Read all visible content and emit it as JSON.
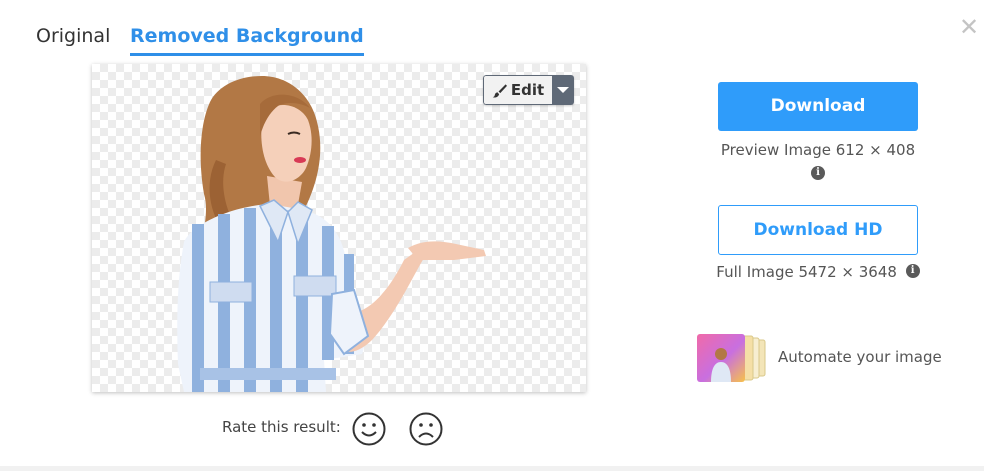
{
  "tabs": {
    "original": "Original",
    "removed_background": "Removed Background",
    "active": "removed_background"
  },
  "close_icon": "close-icon",
  "editor": {
    "edit_label": "Edit",
    "edit_icon": "brush-icon",
    "dropdown_icon": "caret-down-icon"
  },
  "rating": {
    "label": "Rate this result:",
    "positive_icon": "smiley-face-icon",
    "negative_icon": "sad-face-icon"
  },
  "download": {
    "label": "Download",
    "info": "Preview Image 612 × 408"
  },
  "download_hd": {
    "label": "Download HD",
    "info": "Full Image 5472 × 3648"
  },
  "automate": {
    "label": "Automate your image"
  },
  "colors": {
    "accent": "#2f9cfa",
    "tab_active": "#2f8fe8",
    "edit_dark": "#5f6977"
  }
}
